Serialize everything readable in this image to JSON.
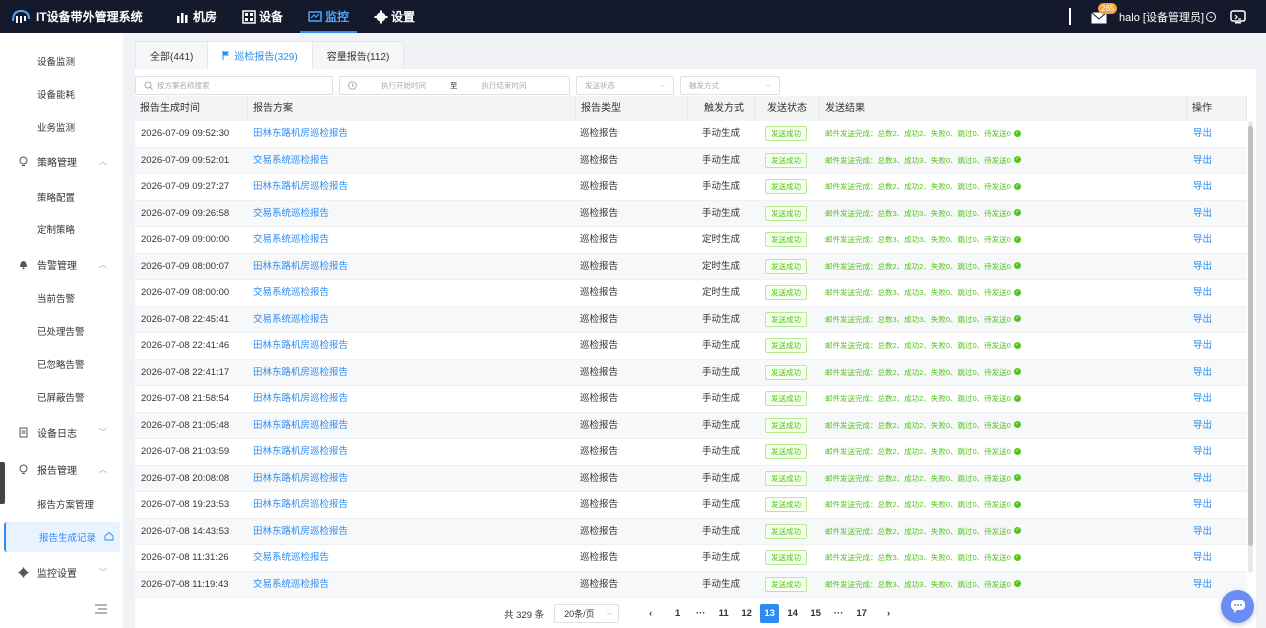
{
  "app": {
    "title": "IT设备带外管理系统"
  },
  "nav": [
    {
      "label": "机房",
      "icon": "bar-chart-icon",
      "active": false
    },
    {
      "label": "设备",
      "icon": "grid-icon",
      "active": false
    },
    {
      "label": "监控",
      "icon": "monitor-icon",
      "active": true
    },
    {
      "label": "设置",
      "icon": "gear-icon",
      "active": false
    }
  ],
  "header": {
    "mail_count": "265",
    "user": "halo [设备管理员]"
  },
  "sidebar": {
    "items": [
      {
        "label": "设备监测",
        "type": "sub"
      },
      {
        "label": "设备能耗",
        "type": "sub"
      },
      {
        "label": "业务监测",
        "type": "sub"
      },
      {
        "label": "策略管理",
        "type": "group",
        "icon": "lightbulb-icon",
        "arrow": "up"
      },
      {
        "label": "策略配置",
        "type": "sub"
      },
      {
        "label": "定制策略",
        "type": "sub"
      },
      {
        "label": "告警管理",
        "type": "group",
        "icon": "bell-icon",
        "arrow": "up"
      },
      {
        "label": "当前告警",
        "type": "sub"
      },
      {
        "label": "已处理告警",
        "type": "sub"
      },
      {
        "label": "已忽略告警",
        "type": "sub"
      },
      {
        "label": "已屏蔽告警",
        "type": "sub"
      },
      {
        "label": "设备日志",
        "type": "group",
        "icon": "log-icon",
        "arrow": "down"
      },
      {
        "label": "报告管理",
        "type": "group",
        "icon": "lightbulb-icon",
        "arrow": "up"
      },
      {
        "label": "报告方案管理",
        "type": "sub"
      },
      {
        "label": "报告生成记录",
        "type": "sub",
        "active": true
      },
      {
        "label": "监控设置",
        "type": "group",
        "icon": "gear-icon",
        "arrow": "down"
      }
    ]
  },
  "tabs": [
    {
      "label": "全部(441)",
      "active": false
    },
    {
      "label": "巡检报告(329)",
      "active": true
    },
    {
      "label": "容量报告(112)",
      "active": false
    }
  ],
  "filters": {
    "search_placeholder": "按方案名称搜索",
    "start_placeholder": "执行开始时间",
    "range_sep": "至",
    "end_placeholder": "执行结束时间",
    "status_placeholder": "发送状态",
    "trigger_placeholder": "触发方式"
  },
  "table": {
    "columns": [
      "报告生成时间",
      "报告方案",
      "报告类型",
      "触发方式",
      "发送状态",
      "发送结果",
      "操作"
    ],
    "rows": [
      [
        "2026-07-09 09:52:30",
        "田林东路机房巡检报告",
        "巡检报告",
        "手动生成",
        "发送成功",
        "邮件发送完成：总数2、成功2、失败0、跳过0、待发送0",
        "导出"
      ],
      [
        "2026-07-09 09:52:01",
        "交易系统巡检报告",
        "巡检报告",
        "手动生成",
        "发送成功",
        "邮件发送完成：总数3、成功3、失败0、跳过0、待发送0",
        "导出"
      ],
      [
        "2026-07-09 09:27:27",
        "田林东路机房巡检报告",
        "巡检报告",
        "手动生成",
        "发送成功",
        "邮件发送完成：总数2、成功2、失败0、跳过0、待发送0",
        "导出"
      ],
      [
        "2026-07-09 09:26:58",
        "交易系统巡检报告",
        "巡检报告",
        "手动生成",
        "发送成功",
        "邮件发送完成：总数3、成功3、失败0、跳过0、待发送0",
        "导出"
      ],
      [
        "2026-07-09 09:00:00",
        "交易系统巡检报告",
        "巡检报告",
        "定时生成",
        "发送成功",
        "邮件发送完成：总数3、成功3、失败0、跳过0、待发送0",
        "导出"
      ],
      [
        "2026-07-09 08:00:07",
        "田林东路机房巡检报告",
        "巡检报告",
        "定时生成",
        "发送成功",
        "邮件发送完成：总数2、成功2、失败0、跳过0、待发送0",
        "导出"
      ],
      [
        "2026-07-09 08:00:00",
        "交易系统巡检报告",
        "巡检报告",
        "定时生成",
        "发送成功",
        "邮件发送完成：总数3、成功3、失败0、跳过0、待发送0",
        "导出"
      ],
      [
        "2026-07-08 22:45:41",
        "交易系统巡检报告",
        "巡检报告",
        "手动生成",
        "发送成功",
        "邮件发送完成：总数3、成功3、失败0、跳过0、待发送0",
        "导出"
      ],
      [
        "2026-07-08 22:41:46",
        "田林东路机房巡检报告",
        "巡检报告",
        "手动生成",
        "发送成功",
        "邮件发送完成：总数2、成功2、失败0、跳过0、待发送0",
        "导出"
      ],
      [
        "2026-07-08 22:41:17",
        "田林东路机房巡检报告",
        "巡检报告",
        "手动生成",
        "发送成功",
        "邮件发送完成：总数2、成功2、失败0、跳过0、待发送0",
        "导出"
      ],
      [
        "2026-07-08 21:58:54",
        "田林东路机房巡检报告",
        "巡检报告",
        "手动生成",
        "发送成功",
        "邮件发送完成：总数2、成功2、失败0、跳过0、待发送0",
        "导出"
      ],
      [
        "2026-07-08 21:05:48",
        "田林东路机房巡检报告",
        "巡检报告",
        "手动生成",
        "发送成功",
        "邮件发送完成：总数2、成功2、失败0、跳过0、待发送0",
        "导出"
      ],
      [
        "2026-07-08 21:03:59",
        "田林东路机房巡检报告",
        "巡检报告",
        "手动生成",
        "发送成功",
        "邮件发送完成：总数2、成功2、失败0、跳过0、待发送0",
        "导出"
      ],
      [
        "2026-07-08 20:08:08",
        "田林东路机房巡检报告",
        "巡检报告",
        "手动生成",
        "发送成功",
        "邮件发送完成：总数2、成功2、失败0、跳过0、待发送0",
        "导出"
      ],
      [
        "2026-07-08 19:23:53",
        "田林东路机房巡检报告",
        "巡检报告",
        "手动生成",
        "发送成功",
        "邮件发送完成：总数2、成功2、失败0、跳过0、待发送0",
        "导出"
      ],
      [
        "2026-07-08 14:43:53",
        "田林东路机房巡检报告",
        "巡检报告",
        "手动生成",
        "发送成功",
        "邮件发送完成：总数2、成功2、失败0、跳过0、待发送0",
        "导出"
      ],
      [
        "2026-07-08 11:31:26",
        "交易系统巡检报告",
        "巡检报告",
        "手动生成",
        "发送成功",
        "邮件发送完成：总数3、成功3、失败0、跳过0、待发送0",
        "导出"
      ],
      [
        "2026-07-08 11:19:43",
        "交易系统巡检报告",
        "巡检报告",
        "手动生成",
        "发送成功",
        "邮件发送完成：总数3、成功3、失败0、跳过0、待发送0",
        "导出"
      ]
    ]
  },
  "pagination": {
    "total_text": "共 329 条",
    "page_size": "20条/页",
    "pages": [
      "1",
      "···",
      "11",
      "12",
      "13",
      "14",
      "15",
      "···",
      "17"
    ],
    "current": "13",
    "prev": "‹",
    "next": "›"
  },
  "colors": {
    "accent": "#2d8cf0",
    "topbar": "#141a2b",
    "success": "#52c41a"
  }
}
